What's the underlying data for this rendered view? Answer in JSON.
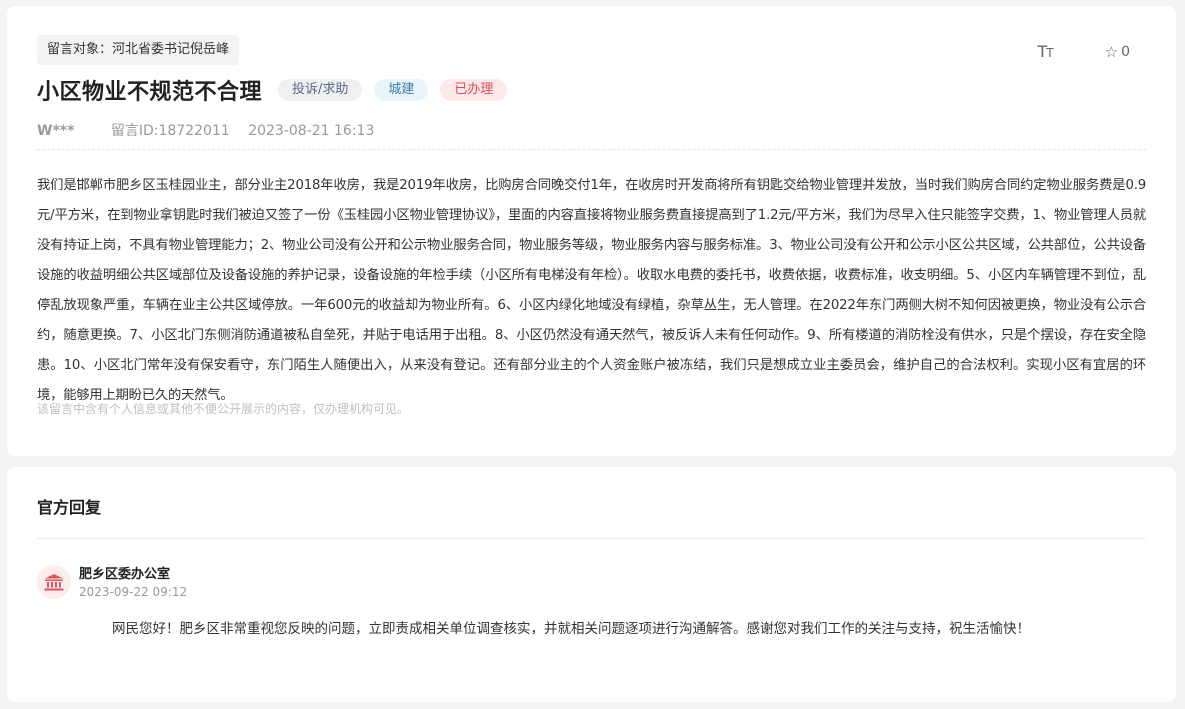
{
  "message": {
    "target": "留言对象：河北省委书记倪岳峰",
    "title": "小区物业不规范不合理",
    "tags": {
      "category": "投诉/求助",
      "domain": "城建",
      "status": "已办理"
    },
    "author": "W***",
    "message_id": "留言ID:18722011",
    "time": "2023-08-21 16:13",
    "content": "我们是邯郸市肥乡区玉桂园业主，部分业主2018年收房，我是2019年收房，比购房合同晚交付1年，在收房时开发商将所有钥匙交给物业管理并发放，当时我们购房合同约定物业服务费是0.9元/平方米，在到物业拿钥匙时我们被迫又签了一份《玉桂园小区物业管理协议》，里面的内容直接将物业服务费直接提高到了1.2元/平方米，我们为尽早入住只能签字交费，1、物业管理人员就没有持证上岗，不具有物业管理能力；2、物业公司没有公开和公示物业服务合同，物业服务等级，物业服务内容与服务标准。3、物业公司没有公开和公示小区公共区域，公共部位，公共设备设施的收益明细公共区域部位及设备设施的养护记录，设备设施的年检手续（小区所有电梯没有年检）。收取水电费的委托书，收费依据，收费标准，收支明细。5、小区内车辆管理不到位，乱停乱放现象严重，车辆在业主公共区域停放。一年600元的收益却为物业所有。6、小区内绿化地域没有绿植，杂草丛生，无人管理。在2022年东门两侧大树不知何因被更换，物业没有公示合约，随意更换。7、小区北门东侧消防通道被私自垒死，并贴于电话用于出租。8、小区仍然没有通天然气，被反诉人未有任何动作。9、所有楼道的消防栓没有供水，只是个摆设，存在安全隐患。10、小区北门常年没有保安看守，东门陌生人随便出入，从来没有登记。还有部分业主的个人资金账户被冻结，我们只是想成立业主委员会，维护自己的合法权利。实现小区有宜居的环境，能够用上期盼已久的天然气。",
    "privacy_notice": "该留言中含有个人信息或其他不便公开展示的内容，仅办理机构可见。"
  },
  "toolbar": {
    "font_size_icon": "font-size-icon",
    "font_size_big": "T",
    "font_size_small": "T",
    "favorite_icon": "star-icon",
    "favorite_count": "0"
  },
  "reply": {
    "section_title": "官方回复",
    "org_icon": "government-building-icon",
    "org_name": "肥乡区委办公室",
    "time": "2023-09-22 09:12",
    "content": "网民您好！肥乡区非常重视您反映的问题，立即责成相关单位调查核实，并就相关问题逐项进行沟通解答。感谢您对我们工作的关注与支持，祝生活愉快！"
  },
  "colors": {
    "page_background": "#f2f3f5",
    "card_background": "#ffffff",
    "category_text": "#5a6b84",
    "domain_text": "#3a7fa8",
    "status_text": "#e34b59",
    "org_icon": "#e0525c"
  }
}
